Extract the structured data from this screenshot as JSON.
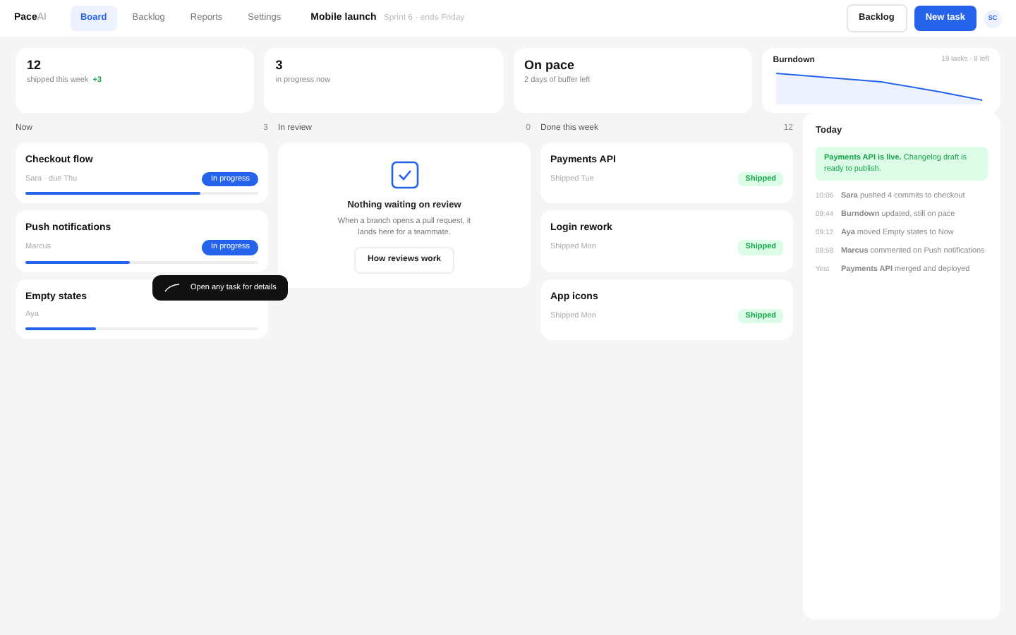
{
  "brand": {
    "name": "Pace",
    "suffix": "AI"
  },
  "nav": [
    {
      "label": "Board",
      "selected": true
    },
    {
      "label": "Backlog",
      "selected": false
    },
    {
      "label": "Reports",
      "selected": false
    },
    {
      "label": "Settings",
      "selected": false
    }
  ],
  "project": {
    "name": "Mobile launch",
    "sprint": "Sprint 6 · ends Friday"
  },
  "actions": {
    "secondary": "Backlog",
    "primary": "New task",
    "avatar": "SC"
  },
  "stats": [
    {
      "value": "12",
      "label": "shipped this week",
      "delta": "+3"
    },
    {
      "value": "3",
      "label": "in progress now"
    },
    {
      "value": "On pace",
      "label": "2 days of buffer left"
    }
  ],
  "burndown": {
    "title": "Burndown",
    "summary": "19 tasks · 8 left"
  },
  "columns": [
    {
      "title": "Now",
      "count": "3",
      "kind": "tasks",
      "cards": [
        {
          "title": "Checkout flow",
          "meta": "Sara · due Thu",
          "status": "In progress",
          "level": 0.75
        },
        {
          "title": "Push notifications",
          "meta": "Marcus",
          "status": "In progress",
          "level": 0.45
        },
        {
          "title": "Empty states",
          "meta": "Aya",
          "level": 0.3
        }
      ]
    },
    {
      "title": "In review",
      "count": "0",
      "kind": "empty",
      "empty": {
        "title": "Nothing waiting on review",
        "text": "When a branch opens a pull request, it lands here for a teammate.",
        "button": "How reviews work"
      }
    },
    {
      "title": "Done this week",
      "count": "12",
      "kind": "done",
      "cards": [
        {
          "title": "Payments API",
          "meta": "Shipped Tue",
          "status": "Shipped"
        },
        {
          "title": "Login rework",
          "meta": "Shipped Mon",
          "status": "Shipped"
        },
        {
          "title": "App icons",
          "meta": "Shipped Mon",
          "status": "Shipped"
        }
      ]
    }
  ],
  "activity": {
    "title": "Today",
    "notice": "**Payments API is live.** Changelog draft is ready to publish.",
    "items": [
      {
        "time": "10:06",
        "text": "**Sara** pushed 4 commits to checkout"
      },
      {
        "time": "09:44",
        "text": "**Burndown** updated, still on pace"
      },
      {
        "time": "09:12",
        "text": "**Aya** moved Empty states to Now"
      },
      {
        "time": "08:58",
        "text": "**Marcus** commented on Push notifications"
      },
      {
        "time": "Yest",
        "text": "**Payments API** merged and deployed"
      }
    ]
  },
  "tooltip": "Open any task for details"
}
